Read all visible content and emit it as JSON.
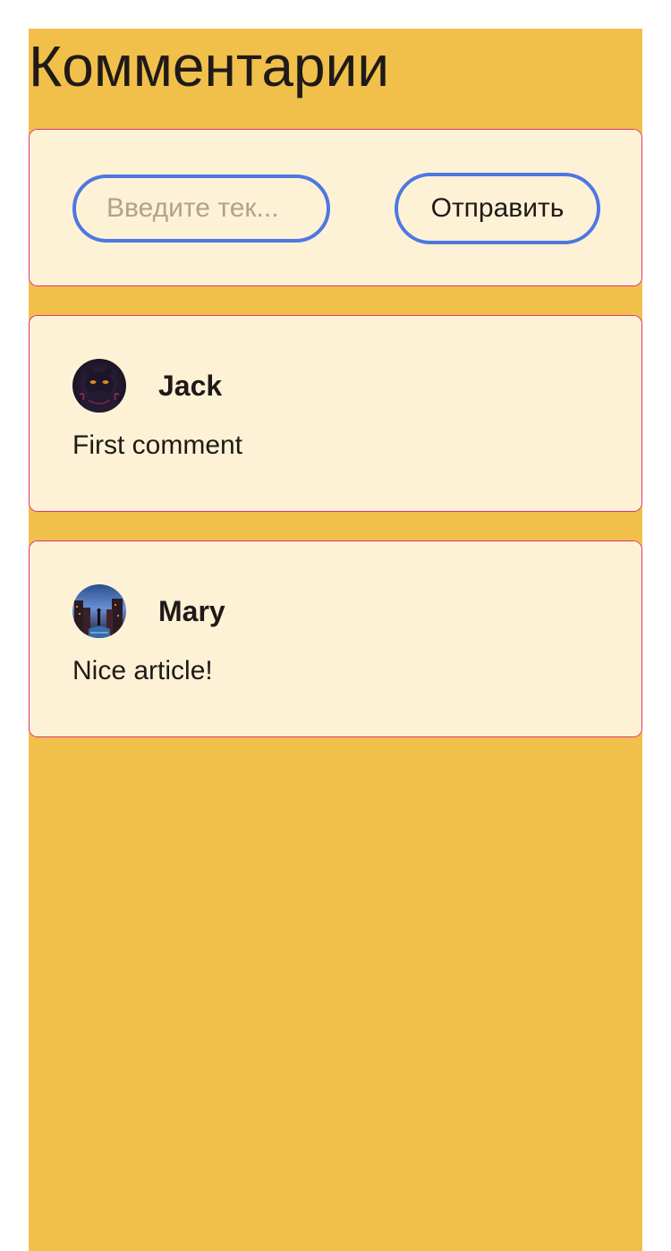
{
  "header": {
    "title": "Комментарии"
  },
  "form": {
    "input_placeholder": "Введите тек...",
    "input_value": "",
    "send_label": "Отправить"
  },
  "comments": [
    {
      "author": "Jack",
      "text": "First comment",
      "avatar_icon": "cat-avatar-image"
    },
    {
      "author": "Mary",
      "text": "Nice article!",
      "avatar_icon": "city-night-avatar-image"
    }
  ],
  "colors": {
    "page_background": "#f0c04b",
    "card_background": "#fdf2d6",
    "accent_border": "#4e77e0",
    "placeholder_text": "#b3a08e"
  }
}
